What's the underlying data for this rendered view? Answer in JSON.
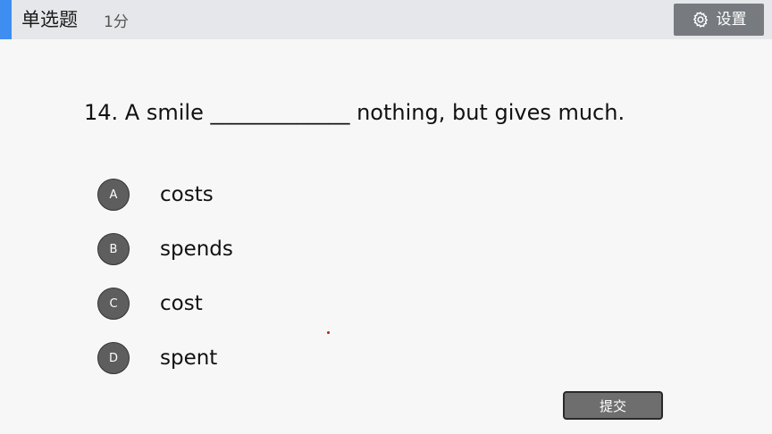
{
  "header": {
    "question_type": "单选题",
    "score": "1分",
    "settings_label": "设置",
    "settings_icon": "gear-icon"
  },
  "question": {
    "text": "14. A smile _____________ nothing, but gives much."
  },
  "options": [
    {
      "letter": "A",
      "text": "costs"
    },
    {
      "letter": "B",
      "text": "spends"
    },
    {
      "letter": "C",
      "text": "cost"
    },
    {
      "letter": "D",
      "text": "spent"
    }
  ],
  "footer": {
    "submit_label": "提交"
  },
  "colors": {
    "accent": "#3d8ef0",
    "header_bg": "#e6e7ea",
    "button_bg": "#777b80",
    "option_circle": "#5e5e5e"
  }
}
